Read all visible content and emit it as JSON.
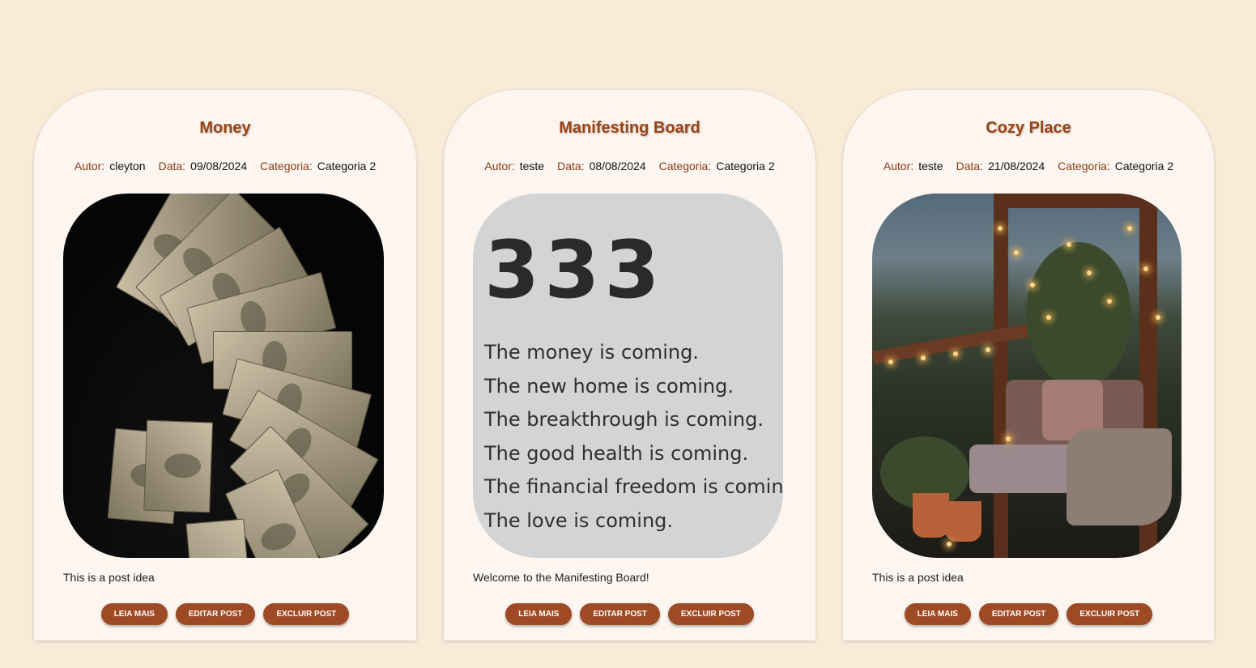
{
  "meta_labels": {
    "author": "Autor:",
    "date": "Data:",
    "category": "Categoria:"
  },
  "buttons": {
    "read_more": "LEIA MAIS",
    "edit": "EDITAR POST",
    "delete": "EXCLUIR POST"
  },
  "posts": [
    {
      "title": "Money",
      "author": "cleyton",
      "date": "09/08/2024",
      "category": "Categoria 2",
      "description": "This is a post idea",
      "image": "money-photo"
    },
    {
      "title": "Manifesting Board",
      "author": "teste",
      "date": "08/08/2024",
      "category": "Categoria 2",
      "description": "Welcome to the Manifesting Board!",
      "image": {
        "heading": "333",
        "lines": [
          "The money is coming.",
          "The new home is coming.",
          "The breakthrough is coming.",
          "The good health is coming.",
          "The financial freedom is coming.",
          "The love is coming."
        ]
      }
    },
    {
      "title": "Cozy Place",
      "author": "teste",
      "date": "21/08/2024",
      "category": "Categoria 2",
      "description": "This is a post idea",
      "image": "cozy-balcony-photo"
    }
  ],
  "colors": {
    "page_bg": "#f8ebd8",
    "card_bg": "#fdf6f0",
    "title": "#9a4416",
    "meta_label": "#8a3a14",
    "button_bg": "#9d4a25"
  }
}
